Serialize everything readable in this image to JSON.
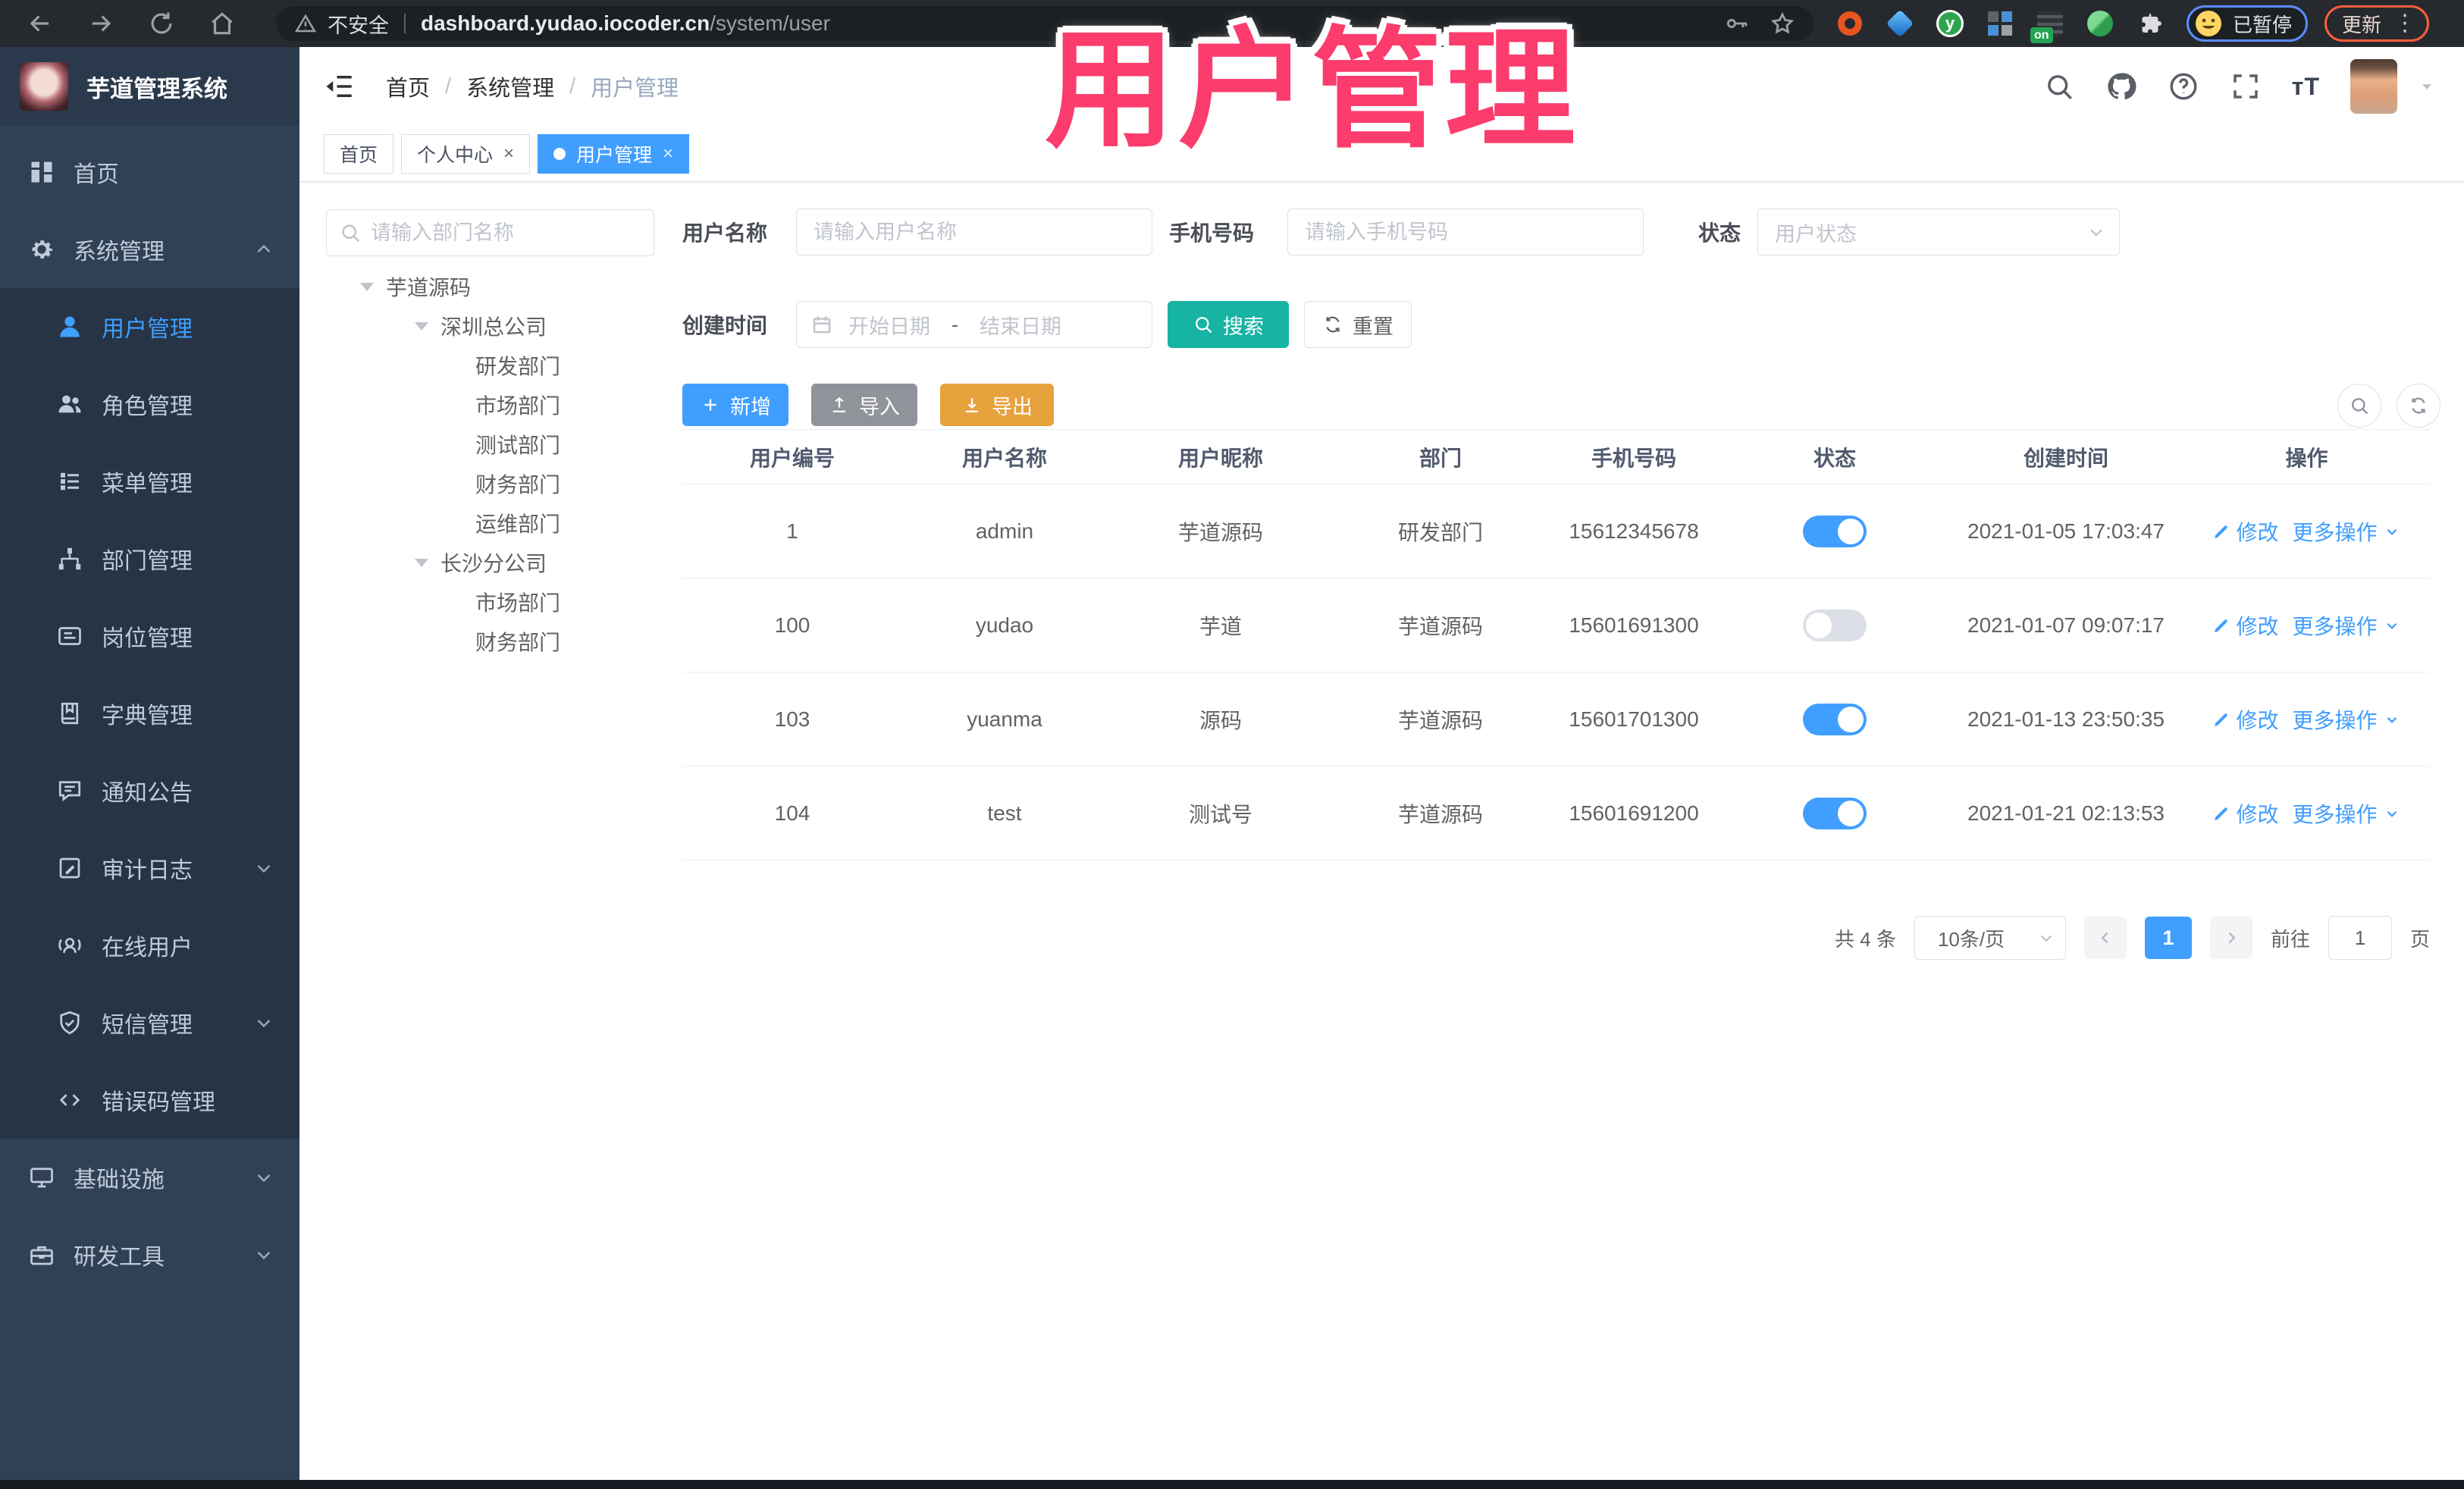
{
  "browser": {
    "security_label": "不安全",
    "url_host": "dashboard.yudao.iocoder.cn",
    "url_path": "/system/user",
    "extension_badge": "on",
    "extension_letter": "y",
    "profile_badge": "已暂停",
    "update_label": "更新"
  },
  "overlay": {
    "title": "用户管理",
    "color": "#fc3c6c"
  },
  "colors": {
    "primary": "#409eff",
    "search_teal": "#17b3a3",
    "warning_orange": "#e6a23c",
    "info_grey": "#909399",
    "sidebar_bg": "#304156",
    "submenu_bg": "#263445"
  },
  "app": {
    "logo_title": "芋道管理系统",
    "breadcrumb": [
      "首页",
      "系统管理",
      "用户管理"
    ],
    "tabs": [
      {
        "key": "home",
        "label": "首页",
        "active": false,
        "closable": false
      },
      {
        "key": "profile",
        "label": "个人中心",
        "active": false,
        "closable": true
      },
      {
        "key": "user",
        "label": "用户管理",
        "active": true,
        "closable": true
      }
    ]
  },
  "sidebar": {
    "items": [
      {
        "key": "home",
        "label": "首页",
        "icon": "dashboard-icon",
        "level": 0
      },
      {
        "key": "system",
        "label": "系统管理",
        "icon": "gear-icon",
        "level": 0,
        "chevron": "up"
      },
      {
        "key": "user",
        "label": "用户管理",
        "icon": "user-icon",
        "level": 1,
        "active": true
      },
      {
        "key": "role",
        "label": "角色管理",
        "icon": "peoples-icon",
        "level": 1
      },
      {
        "key": "menu",
        "label": "菜单管理",
        "icon": "tree-table-icon",
        "level": 1
      },
      {
        "key": "dept",
        "label": "部门管理",
        "icon": "org-tree-icon",
        "level": 1
      },
      {
        "key": "post",
        "label": "岗位管理",
        "icon": "post-icon",
        "level": 1
      },
      {
        "key": "dict",
        "label": "字典管理",
        "icon": "dict-icon",
        "level": 1
      },
      {
        "key": "notice",
        "label": "通知公告",
        "icon": "message-icon",
        "level": 1
      },
      {
        "key": "audit-log",
        "label": "审计日志",
        "icon": "form-icon",
        "level": 1,
        "chevron": "down"
      },
      {
        "key": "online-user",
        "label": "在线用户",
        "icon": "online-icon",
        "level": 1
      },
      {
        "key": "sms",
        "label": "短信管理",
        "icon": "shield-check-icon",
        "level": 1,
        "chevron": "down"
      },
      {
        "key": "error-code",
        "label": "错误码管理",
        "icon": "code-icon",
        "level": 1
      },
      {
        "key": "infra",
        "label": "基础设施",
        "icon": "monitor-icon",
        "level": 0,
        "chevron": "down"
      },
      {
        "key": "dev-tools",
        "label": "研发工具",
        "icon": "toolbox-icon",
        "level": 0,
        "chevron": "down"
      }
    ]
  },
  "dept_panel": {
    "search_placeholder": "请输入部门名称",
    "tree": [
      {
        "label": "芋道源码",
        "level": 0,
        "caret": true
      },
      {
        "label": "深圳总公司",
        "level": 1,
        "caret": true
      },
      {
        "label": "研发部门",
        "level": 2,
        "caret": false
      },
      {
        "label": "市场部门",
        "level": 2,
        "caret": false
      },
      {
        "label": "测试部门",
        "level": 2,
        "caret": false
      },
      {
        "label": "财务部门",
        "level": 2,
        "caret": false
      },
      {
        "label": "运维部门",
        "level": 2,
        "caret": false
      },
      {
        "label": "长沙分公司",
        "level": 1,
        "caret": true
      },
      {
        "label": "市场部门",
        "level": 2,
        "caret": false
      },
      {
        "label": "财务部门",
        "level": 2,
        "caret": false
      }
    ]
  },
  "filter_form": {
    "username": {
      "label": "用户名称",
      "placeholder": "请输入用户名称"
    },
    "mobile": {
      "label": "手机号码",
      "placeholder": "请输入手机号码"
    },
    "status": {
      "label": "状态",
      "placeholder": "用户状态"
    },
    "create_time": {
      "label": "创建时间",
      "start_placeholder": "开始日期",
      "separator": "-",
      "end_placeholder": "结束日期"
    },
    "search_label": "搜索",
    "reset_label": "重置"
  },
  "toolbar": {
    "add_label": "新增",
    "import_label": "导入",
    "export_label": "导出"
  },
  "table": {
    "columns": [
      "用户编号",
      "用户名称",
      "用户昵称",
      "部门",
      "手机号码",
      "状态",
      "创建时间",
      "操作"
    ],
    "rows": [
      {
        "id": "1",
        "username": "admin",
        "nickname": "芋道源码",
        "dept": "研发部门",
        "mobile": "15612345678",
        "status_on": true,
        "created": "2021-01-05 17:03:47"
      },
      {
        "id": "100",
        "username": "yudao",
        "nickname": "芋道",
        "dept": "芋道源码",
        "mobile": "15601691300",
        "status_on": false,
        "created": "2021-01-07 09:07:17"
      },
      {
        "id": "103",
        "username": "yuanma",
        "nickname": "源码",
        "dept": "芋道源码",
        "mobile": "15601701300",
        "status_on": true,
        "created": "2021-01-13 23:50:35"
      },
      {
        "id": "104",
        "username": "test",
        "nickname": "测试号",
        "dept": "芋道源码",
        "mobile": "15601691200",
        "status_on": true,
        "created": "2021-01-21 02:13:53"
      }
    ],
    "actions": {
      "edit": "修改",
      "more": "更多操作"
    }
  },
  "pagination": {
    "total_text": "共 4 条",
    "page_size_text": "10条/页",
    "current_page": "1",
    "goto_label": "前往",
    "goto_value": "1",
    "page_unit": "页"
  }
}
